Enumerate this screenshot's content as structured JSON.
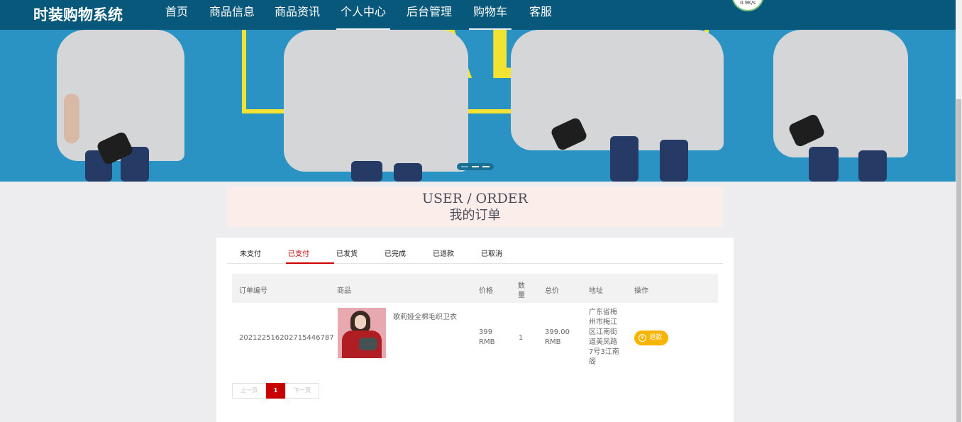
{
  "nav": {
    "brand": "时装购物系统",
    "items": [
      {
        "label": "首页"
      },
      {
        "label": "商品信息"
      },
      {
        "label": "商品资讯"
      },
      {
        "label": "个人中心"
      },
      {
        "label": "后台管理"
      },
      {
        "label": "购物车"
      },
      {
        "label": "客服"
      }
    ],
    "speed_badge": "0.9K/s"
  },
  "banner": {
    "text": "SALE",
    "colors": {
      "background": "#2b93c3",
      "accent": "#f2e232"
    }
  },
  "section": {
    "title_en": "USER / ORDER",
    "title_zh": "我的订单"
  },
  "tabs": [
    "未支付",
    "已支付",
    "已发货",
    "已完成",
    "已退款",
    "已取消"
  ],
  "active_tab": "已支付",
  "table": {
    "headers": {
      "order_no": "订单编号",
      "product": "商品",
      "price": "价格",
      "qty_1": "数",
      "qty_2": "量",
      "total": "总价",
      "address": "地址",
      "action": "操作"
    },
    "rows": [
      {
        "order_no": "20212251620271544678 7",
        "order_no_display": "202122516202715446787",
        "product_name": "歌莉娅全棉毛织卫衣",
        "price_value": "399",
        "price_unit": "RMB",
        "qty": "1",
        "total_value": "399.00",
        "total_unit": "RMB",
        "address_lines": [
          "广东省梅",
          "州市梅江",
          "区江南街",
          "道美凤路",
          "7号3江南",
          "阁"
        ],
        "action_label": "退款"
      }
    ]
  },
  "pagination": {
    "prev": "上一页",
    "current": "1",
    "next": "下一页"
  },
  "colors": {
    "nav_bg": "#07587a",
    "active_tab": "#cc0000",
    "refund_button": "#f7b500",
    "current_page": "#c90000"
  }
}
